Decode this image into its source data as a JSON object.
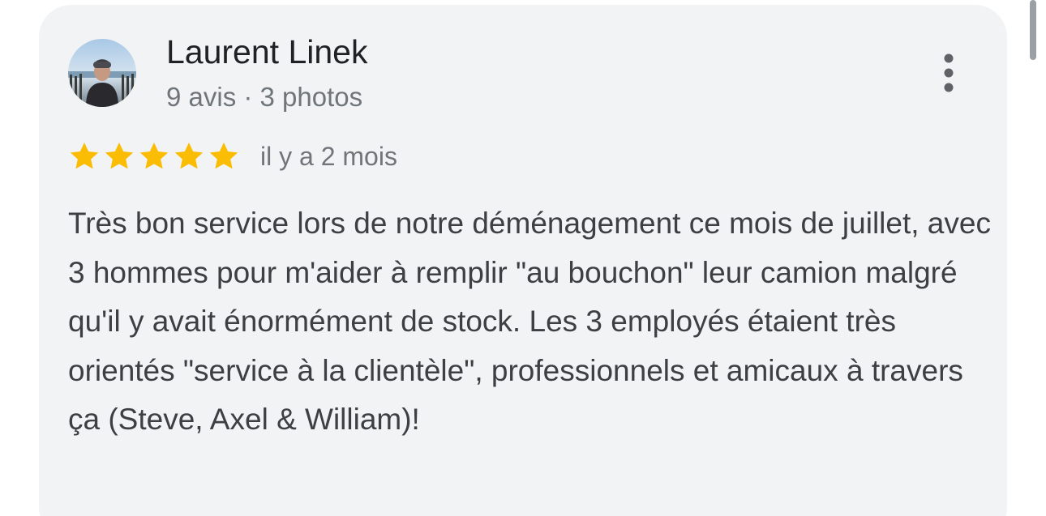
{
  "review": {
    "reviewer_name": "Laurent Linek",
    "reviewer_meta": "9 avis · 3 photos",
    "rating_stars": 5,
    "star_color": "#fbbc04",
    "date": "il y a 2 mois",
    "text": "Très bon service lors de notre déménagement ce mois de juillet, avec 3 hommes pour m'aider à remplir \"au bouchon\" leur camion malgré qu'il y avait énormément de stock. Les 3 employés étaient très orientés \"service à la clientèle\", professionnels et amicaux à travers ça (Steve, Axel & William)!",
    "more_icon": "more-vert-icon"
  },
  "colors": {
    "card_background": "#f1f3f4",
    "name_text": "#202124",
    "secondary_text": "#70757a",
    "body_text": "#3c4043"
  }
}
